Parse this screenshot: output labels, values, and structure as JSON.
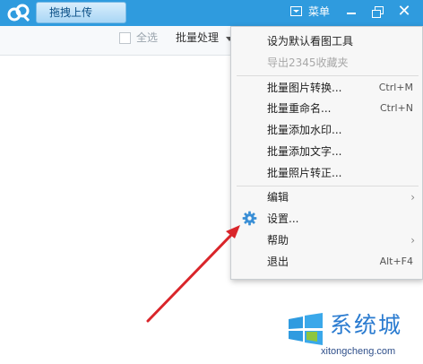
{
  "titlebar": {
    "upload_label": "拖拽上传",
    "menu_label": "菜单",
    "color": "#2f9bde"
  },
  "toolbar": {
    "select_all": "全选",
    "batch": "批量处理"
  },
  "menu": {
    "items": [
      {
        "label": "设为默认看图工具",
        "shortcut": ""
      },
      {
        "label": "导出2345收藏夹",
        "shortcut": "",
        "disabled": true
      },
      {
        "label": "批量图片转换...",
        "shortcut": "Ctrl+M"
      },
      {
        "label": "批量重命名...",
        "shortcut": "Ctrl+N"
      },
      {
        "label": "批量添加水印...",
        "shortcut": ""
      },
      {
        "label": "批量添加文字...",
        "shortcut": ""
      },
      {
        "label": "批量照片转正...",
        "shortcut": ""
      },
      {
        "label": "编辑",
        "shortcut": "",
        "submenu": true
      },
      {
        "label": "设置...",
        "shortcut": "",
        "icon": "gear-icon"
      },
      {
        "label": "帮助",
        "shortcut": "",
        "submenu": true
      },
      {
        "label": "退出",
        "shortcut": "Alt+F4"
      }
    ]
  },
  "annotation": {
    "arrow_color": "#d9252a"
  },
  "watermark": {
    "brand": "系统城",
    "url": "xitongcheng.com"
  }
}
